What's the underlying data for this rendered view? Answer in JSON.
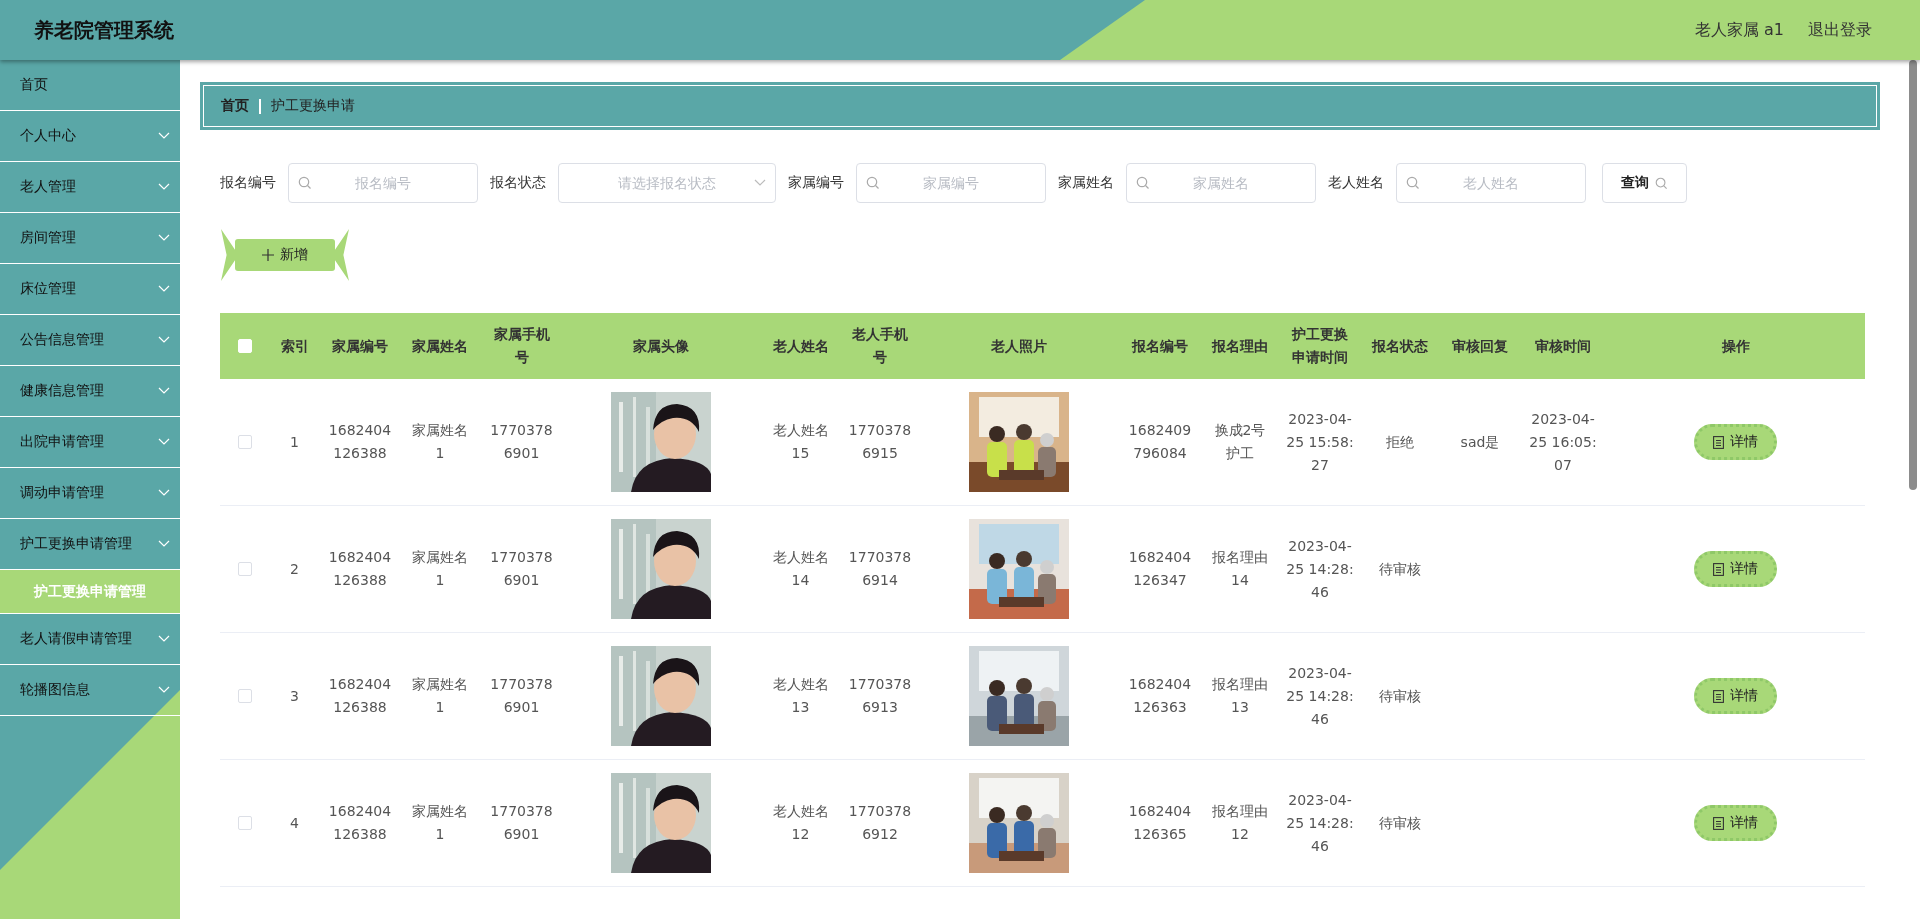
{
  "header": {
    "title": "养老院管理系统",
    "user": "老人家属 a1",
    "logout": "退出登录"
  },
  "sidebar": {
    "items": [
      {
        "label": "首页",
        "kind": "link",
        "selected": false
      },
      {
        "label": "个人中心",
        "kind": "menu",
        "selected": false
      },
      {
        "label": "老人管理",
        "kind": "menu",
        "selected": false
      },
      {
        "label": "房间管理",
        "kind": "menu",
        "selected": false
      },
      {
        "label": "床位管理",
        "kind": "menu",
        "selected": false
      },
      {
        "label": "公告信息管理",
        "kind": "menu",
        "selected": false
      },
      {
        "label": "健康信息管理",
        "kind": "menu",
        "selected": false
      },
      {
        "label": "出院申请管理",
        "kind": "menu",
        "selected": false
      },
      {
        "label": "调动申请管理",
        "kind": "menu",
        "selected": false
      },
      {
        "label": "护工更换申请管理",
        "kind": "menu",
        "selected": false,
        "expanded": true,
        "children": [
          {
            "label": "护工更换申请管理",
            "selected": true
          }
        ]
      },
      {
        "label": "老人请假申请管理",
        "kind": "menu",
        "selected": false
      },
      {
        "label": "轮播图信息",
        "kind": "menu",
        "selected": false
      }
    ]
  },
  "breadcrumb": [
    "首页",
    "护工更换申请"
  ],
  "filters": [
    {
      "label": "报名编号",
      "kind": "input",
      "placeholder": "报名编号"
    },
    {
      "label": "报名状态",
      "kind": "select",
      "placeholder": "请选择报名状态"
    },
    {
      "label": "家属编号",
      "kind": "input",
      "placeholder": "家属编号"
    },
    {
      "label": "家属姓名",
      "kind": "input",
      "placeholder": "家属姓名"
    },
    {
      "label": "老人姓名",
      "kind": "input",
      "placeholder": "老人姓名"
    }
  ],
  "search_button": "查询",
  "add_button": "新增",
  "table": {
    "select_all_checked": false,
    "columns": [
      {
        "label": "索引",
        "kind": "text"
      },
      {
        "label": "家属编号",
        "kind": "text"
      },
      {
        "label": "家属姓名",
        "kind": "text"
      },
      {
        "label": "家属手机号",
        "kind": "text"
      },
      {
        "label": "家属头像",
        "kind": "avatar"
      },
      {
        "label": "老人姓名",
        "kind": "text"
      },
      {
        "label": "老人手机号",
        "kind": "text"
      },
      {
        "label": "老人照片"
      },
      {
        "label": "报名编号",
        "kind": "text"
      },
      {
        "label": "报名理由",
        "kind": "text"
      },
      {
        "label": "护工更换申请时间",
        "kind": "text"
      },
      {
        "label": "报名状态",
        "kind": "text"
      },
      {
        "label": "审核回复",
        "kind": "text"
      },
      {
        "label": "审核时间",
        "kind": "text"
      },
      {
        "label": "操作",
        "kind": "action"
      }
    ],
    "rows": [
      {
        "checked": false,
        "cells": [
          "1",
          "1682404\n126388",
          "家属姓名\n1",
          "1770378\n6901",
          {
            "kind": "picture"
          },
          "老人姓名\n15",
          "1770378\n6915",
          {
            "kind": "picture"
          },
          "1682409\n796084",
          "换成2号护工",
          "2023-04-\n25 15:58:\n27",
          "拒绝",
          "sad是",
          "2023-04-\n25 16:05:\n07",
          "详情"
        ]
      },
      {
        "checked": false,
        "cells": [
          "2",
          "1682404\n126388",
          "家属姓名\n1",
          "1770378\n6901",
          {
            "kind": "picture"
          },
          "老人姓名\n14",
          "1770378\n6914",
          {
            "kind": "picture"
          },
          "1682404\n126347",
          "报名理由\n14",
          "2023-04-\n25 14:28:\n46",
          "待审核",
          "",
          "",
          "详情"
        ]
      },
      {
        "checked": false,
        "cells": [
          "3",
          "1682404\n126388",
          "家属姓名\n1",
          "1770378\n6901",
          {
            "kind": "picture"
          },
          "老人姓名\n13",
          "1770378\n6913",
          {
            "kind": "picture"
          },
          "1682404\n126363",
          "报名理由\n13",
          "2023-04-\n25 14:28:\n46",
          "待审核",
          "",
          "",
          "详情"
        ]
      },
      {
        "checked": false,
        "cells": [
          "4",
          "1682404\n126388",
          "家属姓名\n1",
          "1770378\n6901",
          {
            "kind": "picture"
          },
          "老人姓名\n12",
          "1770378\n6912",
          {
            "kind": "picture"
          },
          "1682404\n126365",
          "报名理由\n12",
          "2023-04-\n25 14:28:\n46",
          "待审核",
          "",
          "",
          "详情"
        ]
      }
    ]
  }
}
